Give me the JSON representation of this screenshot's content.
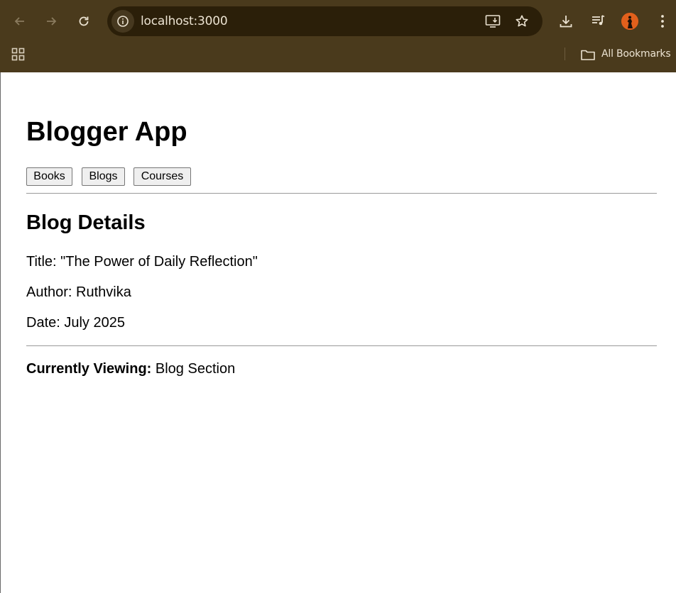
{
  "browser": {
    "url": "localhost:3000",
    "bookmarks_label": "All Bookmarks",
    "theme_color": "#4a3a1c",
    "omnibox_color": "#2b1f09"
  },
  "app": {
    "title": "Blogger App",
    "nav": [
      "Books",
      "Blogs",
      "Courses"
    ]
  },
  "blog": {
    "heading": "Blog Details",
    "title_line": "Title: \"The Power of Daily Reflection\"",
    "author_line": "Author: Ruthvika",
    "date_line": "Date: July 2025"
  },
  "status": {
    "label": "Currently Viewing:",
    "value": "Blog Section"
  }
}
